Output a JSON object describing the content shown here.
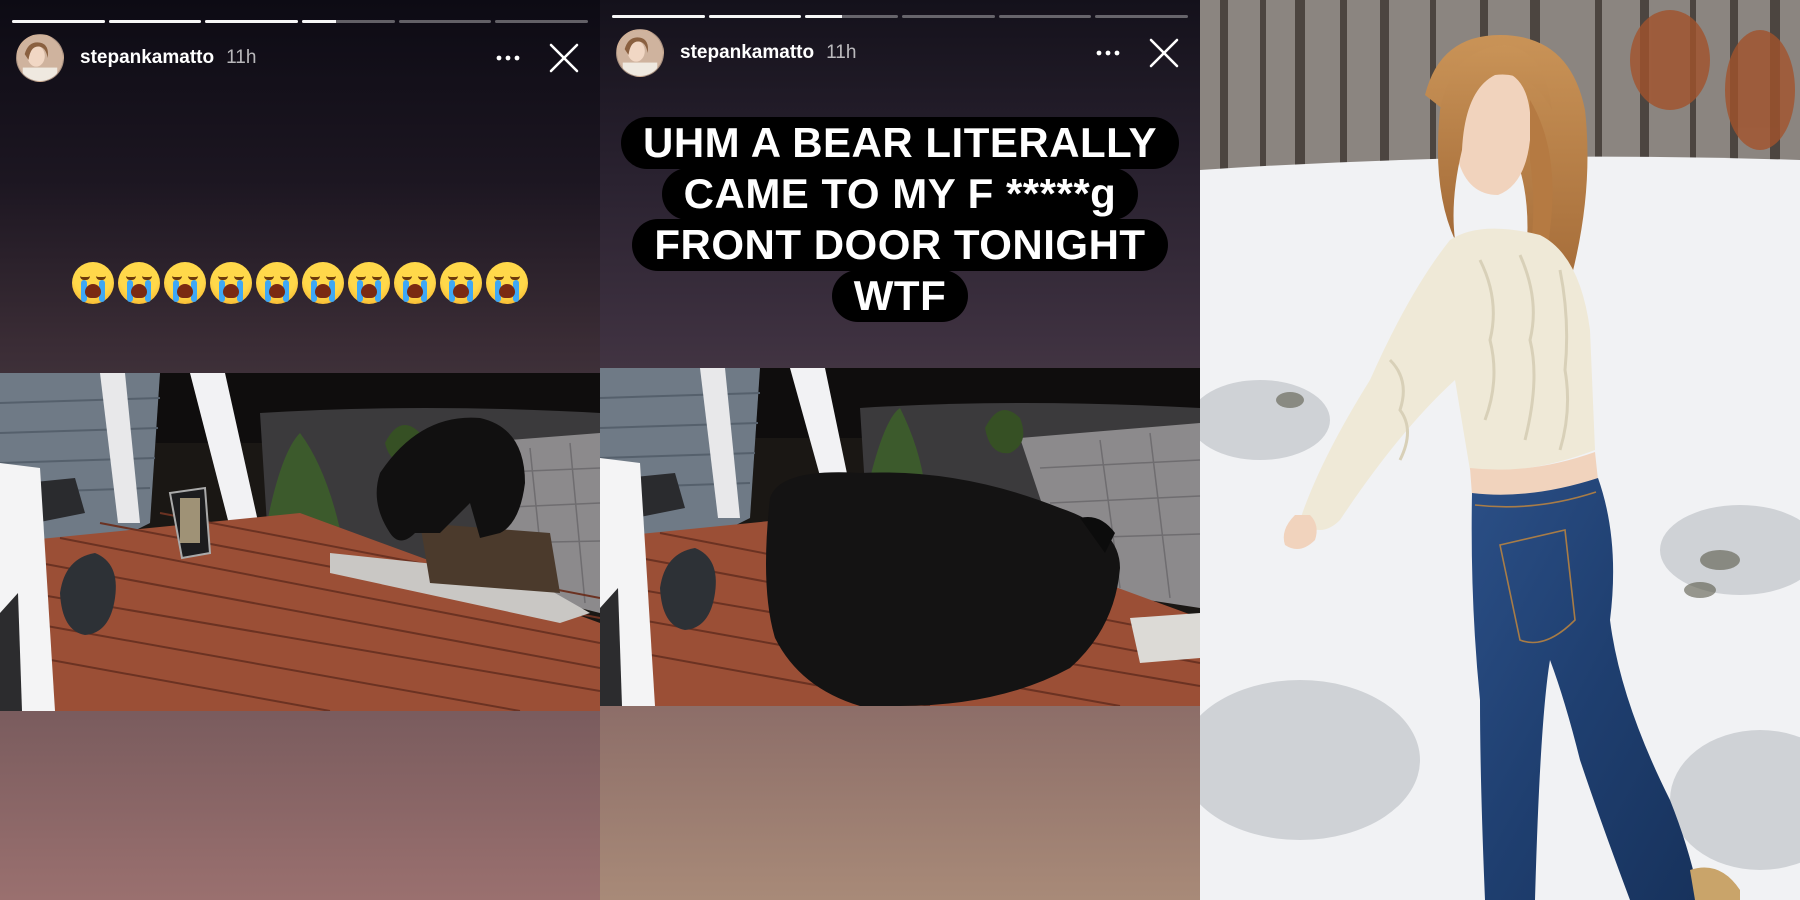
{
  "stories": [
    {
      "username": "stepankamatto",
      "timestamp": "11h",
      "progress": [
        1,
        1,
        1,
        0.37,
        0,
        0
      ],
      "emoji_count": 10,
      "emoji_name": "loudly-crying-face"
    },
    {
      "username": "stepankamatto",
      "timestamp": "11h",
      "progress": [
        1,
        1,
        0.4,
        0,
        0,
        0
      ],
      "caption": {
        "line1": "UHM A BEAR LITERALLY",
        "line2": "CAME TO MY F   *****g",
        "line3": "FRONT DOOR TONIGHT",
        "line4": "WTF"
      }
    }
  ],
  "icons": {
    "more": "more-horizontal-icon",
    "close": "close-icon"
  },
  "colors": {
    "text": "#ffffff",
    "caption_bg": "#000000",
    "progress_fill": "#ffffff"
  }
}
